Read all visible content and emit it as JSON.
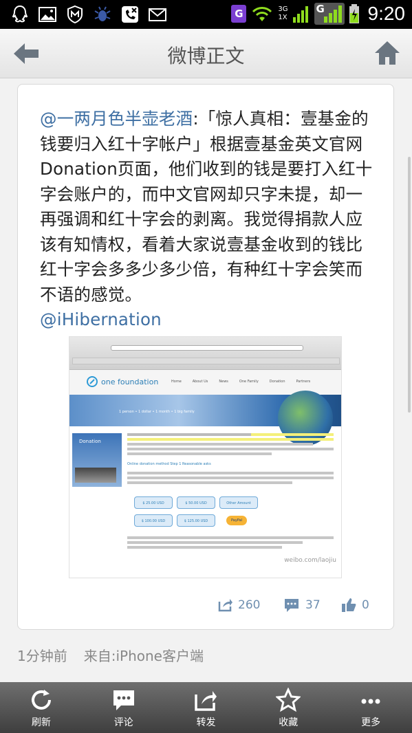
{
  "status_bar": {
    "time": "9:20",
    "network_top": "3G",
    "network_bottom": "1X",
    "g_badge": "G",
    "g_network": "G"
  },
  "header": {
    "title": "微博正文"
  },
  "post": {
    "author_mention": "@一两月色半壶老酒",
    "body": ":「惊人真相：壹基金的钱要归入红十字帐户」根据壹基金英文官网Donation页面，他们收到的钱是要打入红十字会账户的，而中文官网却只字未提，却一再强调和红十字会的剥离。我觉得捐款人应该有知情权，看着大家说壹基金收到的钱比红十字会多多少多少倍，有种红十字会笑而不语的感觉。",
    "trailing_mention": "@iHibernation",
    "image": {
      "site_logo_text": "one foundation",
      "nav_items": [
        "Home",
        "About Us",
        "News",
        "One Family",
        "Donation",
        "Partners"
      ],
      "banner_text": "1 person • 1 dollar • 1 month • 1 big family",
      "sidebar_title": "Donation",
      "section_title": "Online donation method   Step 1   Reasonable asks",
      "amount_buttons": [
        "$ 25.00 USD",
        "$ 50.00 USD",
        "Other Amount",
        "$ 100.00 USD",
        "$ 125.00 USD"
      ],
      "paypal_label": "PayPal",
      "watermark": "weibo.com/laojiu"
    },
    "repost_count": "260",
    "comment_count": "37",
    "like_count": "0",
    "time_ago": "1分钟前",
    "source": "来自:iPhone客户端"
  },
  "toolbar": {
    "items": [
      {
        "label": "刷新",
        "icon": "refresh-icon"
      },
      {
        "label": "评论",
        "icon": "comment-icon"
      },
      {
        "label": "转发",
        "icon": "forward-icon"
      },
      {
        "label": "收藏",
        "icon": "star-icon"
      },
      {
        "label": "更多",
        "icon": "more-icon"
      }
    ]
  },
  "colors": {
    "mention": "#3e6fa3",
    "meta": "#888888",
    "toolbar": "#4a4a4a",
    "highlight": "#f4f07a"
  }
}
